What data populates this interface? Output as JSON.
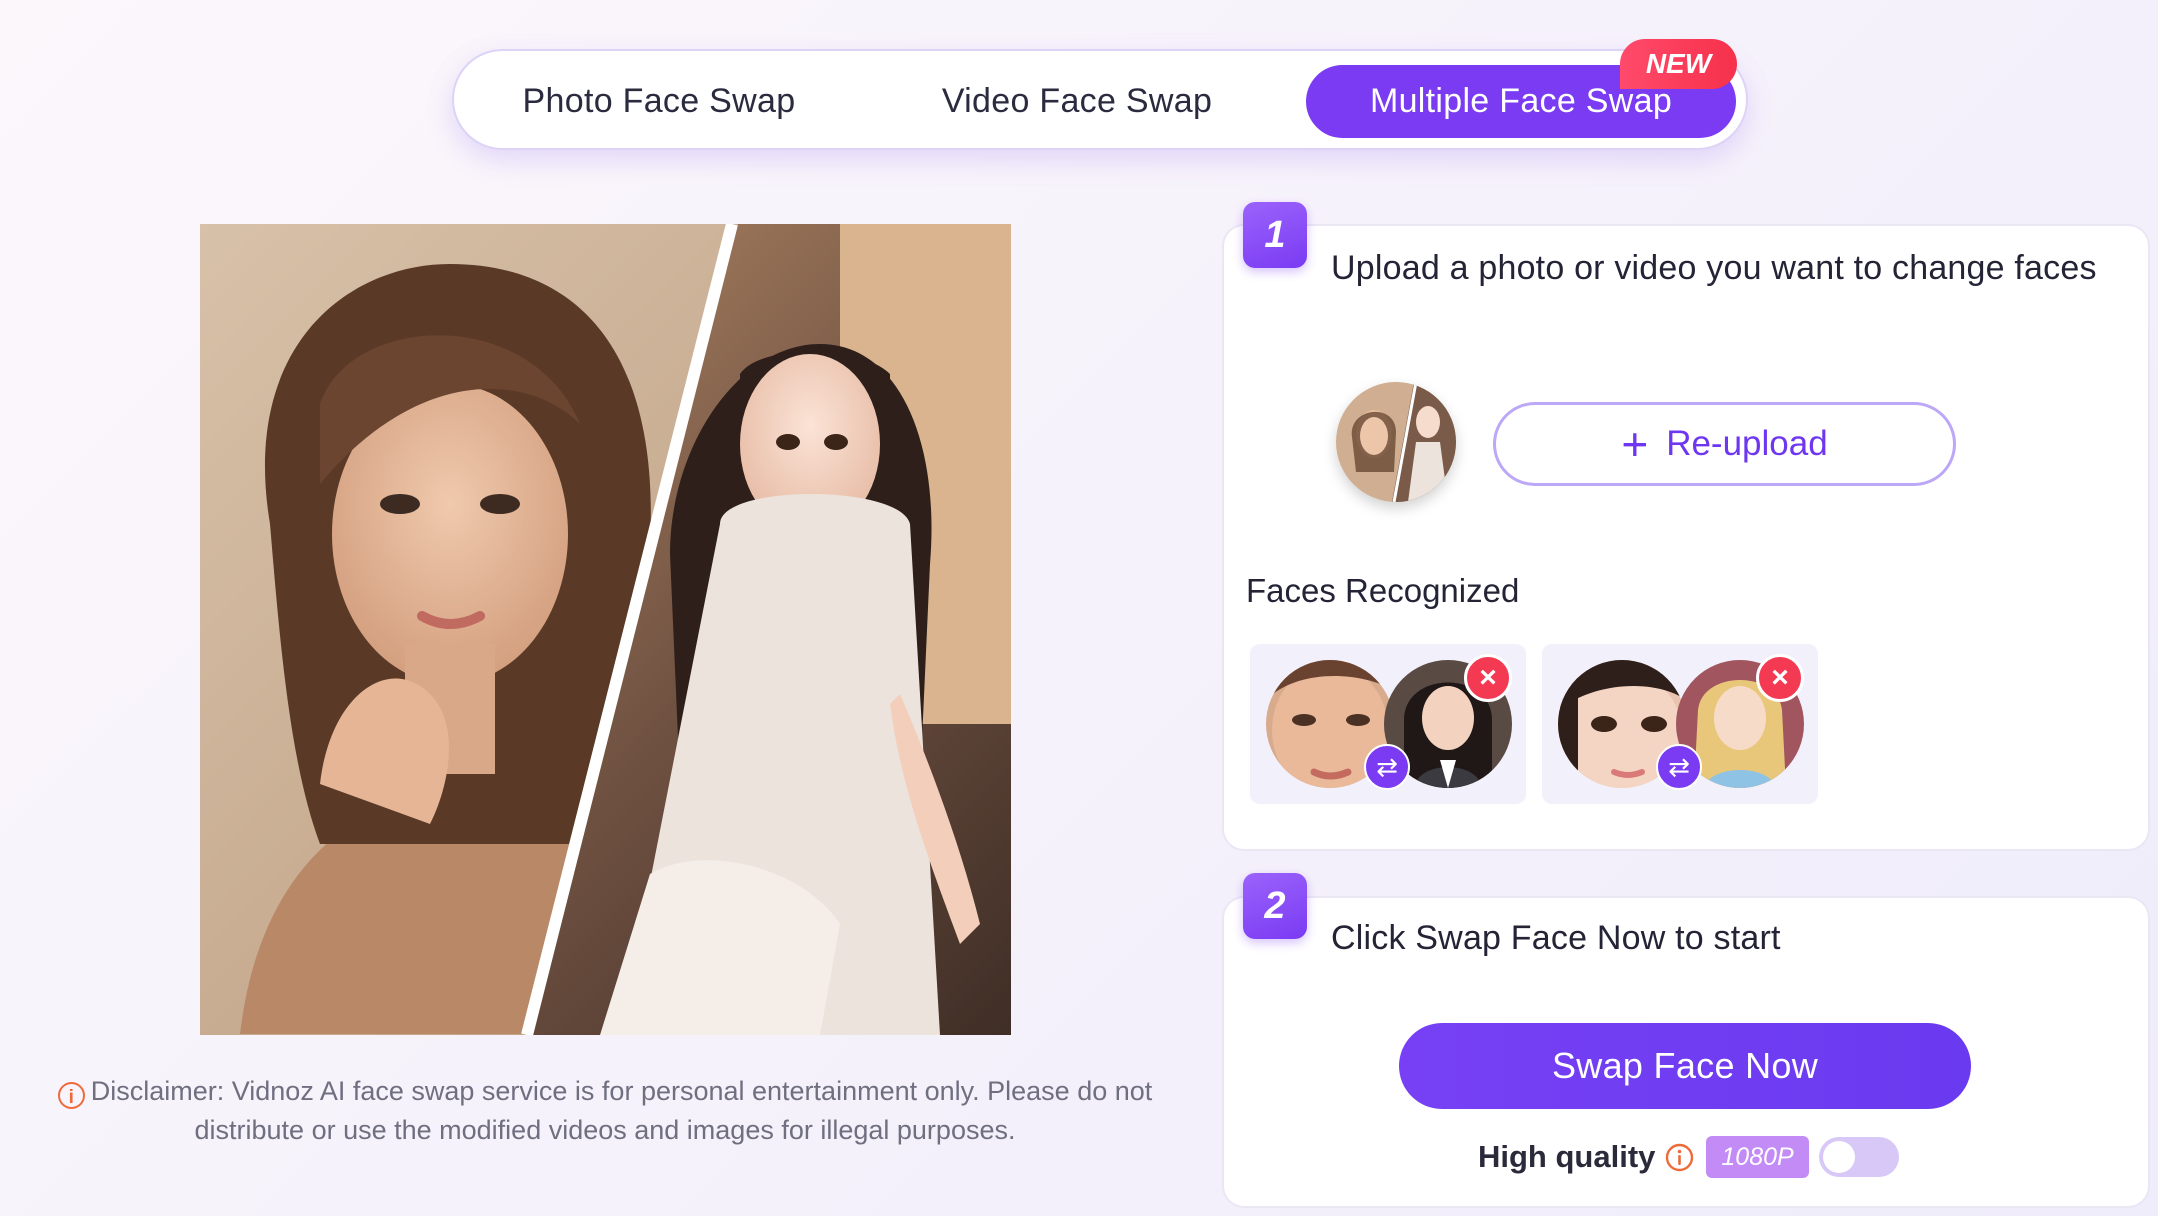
{
  "tabs": [
    {
      "label": "Photo Face Swap",
      "active": false
    },
    {
      "label": "Video Face Swap",
      "active": false
    },
    {
      "label": "Multiple Face Swap",
      "active": true
    }
  ],
  "new_badge": "NEW",
  "disclaimer": {
    "icon": "info-icon",
    "text": "Disclaimer: Vidnoz AI face swap service is for personal entertainment only. Please do not distribute or use the modified videos and images for illegal purposes."
  },
  "step1": {
    "number": "1",
    "title": "Upload a photo or video you want to change faces",
    "reupload_label": "Re-upload",
    "faces_label": "Faces Recognized"
  },
  "step2": {
    "number": "2",
    "title": "Click Swap Face Now to start",
    "button_label": "Swap Face Now",
    "hq_label": "High quality",
    "resolution_badge": "1080P",
    "hq_enabled": false
  },
  "colors": {
    "accent": "#7a3bf3",
    "badge_red": "#f43a53",
    "info_orange": "#ef6a3a",
    "resolution_badge": "#c28bf6"
  }
}
